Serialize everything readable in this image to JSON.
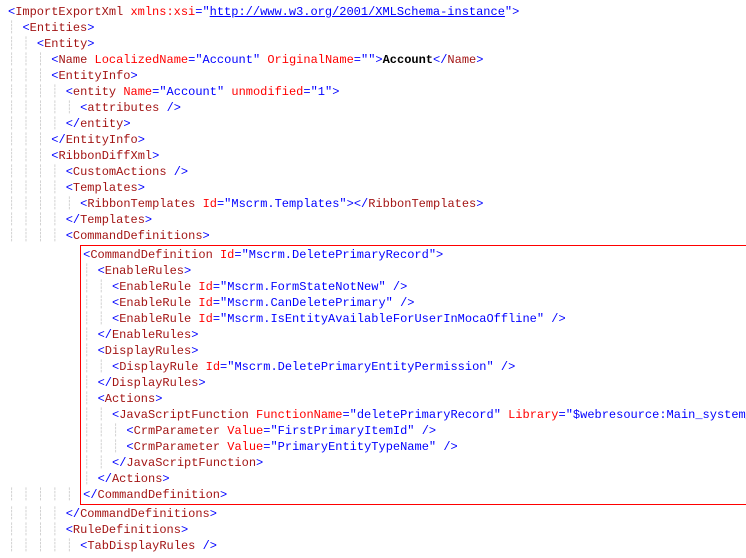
{
  "xsi_url": "http://www.w3.org/2001/XMLSchema-instance",
  "lines": [
    {
      "indent": 0,
      "parts": [
        {
          "t": "bracket",
          "v": "<"
        },
        {
          "t": "tag",
          "v": "ImportExportXml"
        },
        {
          "t": "plain",
          "v": " "
        },
        {
          "t": "attr-name",
          "v": "xmlns:xsi"
        },
        {
          "t": "bracket",
          "v": "="
        },
        {
          "t": "bracket",
          "v": "\""
        },
        {
          "t": "xsi",
          "v": "http://www.w3.org/2001/XMLSchema-instance"
        },
        {
          "t": "bracket",
          "v": "\""
        },
        {
          "t": "bracket",
          "v": ">"
        }
      ]
    },
    {
      "indent": 1,
      "parts": [
        {
          "t": "bracket",
          "v": "<"
        },
        {
          "t": "tag",
          "v": "Entities"
        },
        {
          "t": "bracket",
          "v": ">"
        }
      ]
    },
    {
      "indent": 2,
      "parts": [
        {
          "t": "bracket",
          "v": "<"
        },
        {
          "t": "tag",
          "v": "Entity"
        },
        {
          "t": "bracket",
          "v": ">"
        }
      ]
    },
    {
      "indent": 3,
      "parts": [
        {
          "t": "bracket",
          "v": "<"
        },
        {
          "t": "tag",
          "v": "Name"
        },
        {
          "t": "plain",
          "v": " "
        },
        {
          "t": "attr-name",
          "v": "LocalizedName"
        },
        {
          "t": "bracket",
          "v": "=\""
        },
        {
          "t": "attr-val",
          "v": "Account"
        },
        {
          "t": "bracket",
          "v": "\""
        },
        {
          "t": "plain",
          "v": " "
        },
        {
          "t": "attr-name",
          "v": "OriginalName"
        },
        {
          "t": "bracket",
          "v": "=\""
        },
        {
          "t": "attr-val",
          "v": ""
        },
        {
          "t": "bracket",
          "v": "\""
        },
        {
          "t": "bracket",
          "v": ">"
        },
        {
          "t": "text-content",
          "v": "Account"
        },
        {
          "t": "bracket",
          "v": "</"
        },
        {
          "t": "tag",
          "v": "Name"
        },
        {
          "t": "bracket",
          "v": ">"
        }
      ]
    },
    {
      "indent": 3,
      "parts": [
        {
          "t": "bracket",
          "v": "<"
        },
        {
          "t": "tag",
          "v": "EntityInfo"
        },
        {
          "t": "bracket",
          "v": ">"
        }
      ]
    },
    {
      "indent": 4,
      "parts": [
        {
          "t": "bracket",
          "v": "<"
        },
        {
          "t": "tag",
          "v": "entity"
        },
        {
          "t": "plain",
          "v": " "
        },
        {
          "t": "attr-name",
          "v": "Name"
        },
        {
          "t": "bracket",
          "v": "=\""
        },
        {
          "t": "attr-val",
          "v": "Account"
        },
        {
          "t": "bracket",
          "v": "\""
        },
        {
          "t": "plain",
          "v": " "
        },
        {
          "t": "attr-name",
          "v": "unmodified"
        },
        {
          "t": "bracket",
          "v": "=\""
        },
        {
          "t": "attr-val",
          "v": "1"
        },
        {
          "t": "bracket",
          "v": "\""
        },
        {
          "t": "bracket",
          "v": ">"
        }
      ]
    },
    {
      "indent": 5,
      "parts": [
        {
          "t": "bracket",
          "v": "<"
        },
        {
          "t": "tag",
          "v": "attributes"
        },
        {
          "t": "plain",
          "v": " "
        },
        {
          "t": "bracket",
          "v": "/>"
        }
      ]
    },
    {
      "indent": 4,
      "parts": [
        {
          "t": "bracket",
          "v": "</"
        },
        {
          "t": "tag",
          "v": "entity"
        },
        {
          "t": "bracket",
          "v": ">"
        }
      ]
    },
    {
      "indent": 3,
      "parts": [
        {
          "t": "bracket",
          "v": "</"
        },
        {
          "t": "tag",
          "v": "EntityInfo"
        },
        {
          "t": "bracket",
          "v": ">"
        }
      ]
    },
    {
      "indent": 3,
      "parts": [
        {
          "t": "bracket",
          "v": "<"
        },
        {
          "t": "tag",
          "v": "RibbonDiffXml"
        },
        {
          "t": "bracket",
          "v": ">"
        }
      ]
    },
    {
      "indent": 4,
      "parts": [
        {
          "t": "bracket",
          "v": "<"
        },
        {
          "t": "tag",
          "v": "CustomActions"
        },
        {
          "t": "plain",
          "v": " "
        },
        {
          "t": "bracket",
          "v": "/>"
        }
      ]
    },
    {
      "indent": 4,
      "parts": [
        {
          "t": "bracket",
          "v": "<"
        },
        {
          "t": "tag",
          "v": "Templates"
        },
        {
          "t": "bracket",
          "v": ">"
        }
      ]
    },
    {
      "indent": 5,
      "parts": [
        {
          "t": "bracket",
          "v": "<"
        },
        {
          "t": "tag",
          "v": "RibbonTemplates"
        },
        {
          "t": "plain",
          "v": " "
        },
        {
          "t": "attr-name",
          "v": "Id"
        },
        {
          "t": "bracket",
          "v": "=\""
        },
        {
          "t": "attr-val",
          "v": "Mscrm.Templates"
        },
        {
          "t": "bracket",
          "v": "\""
        },
        {
          "t": "bracket",
          "v": ">"
        },
        {
          "t": "bracket",
          "v": "</"
        },
        {
          "t": "tag",
          "v": "RibbonTemplates"
        },
        {
          "t": "bracket",
          "v": ">"
        }
      ]
    },
    {
      "indent": 4,
      "parts": [
        {
          "t": "bracket",
          "v": "</"
        },
        {
          "t": "tag",
          "v": "Templates"
        },
        {
          "t": "bracket",
          "v": ">"
        }
      ]
    },
    {
      "indent": 4,
      "parts": [
        {
          "t": "bracket",
          "v": "<"
        },
        {
          "t": "tag",
          "v": "CommandDefinitions"
        },
        {
          "t": "bracket",
          "v": ">"
        }
      ]
    }
  ],
  "boxed_lines": [
    {
      "indent": 5,
      "parts": [
        {
          "t": "bracket",
          "v": "<"
        },
        {
          "t": "tag",
          "v": "CommandDefinition"
        },
        {
          "t": "plain",
          "v": " "
        },
        {
          "t": "attr-name",
          "v": "Id"
        },
        {
          "t": "bracket",
          "v": "=\""
        },
        {
          "t": "attr-val",
          "v": "Mscrm.DeletePrimaryRecord"
        },
        {
          "t": "bracket",
          "v": "\""
        },
        {
          "t": "bracket",
          "v": ">"
        }
      ]
    },
    {
      "indent": 6,
      "parts": [
        {
          "t": "bracket",
          "v": "<"
        },
        {
          "t": "tag",
          "v": "EnableRules"
        },
        {
          "t": "bracket",
          "v": ">"
        }
      ]
    },
    {
      "indent": 7,
      "parts": [
        {
          "t": "bracket",
          "v": "<"
        },
        {
          "t": "tag",
          "v": "EnableRule"
        },
        {
          "t": "plain",
          "v": " "
        },
        {
          "t": "attr-name",
          "v": "Id"
        },
        {
          "t": "bracket",
          "v": "=\""
        },
        {
          "t": "attr-val",
          "v": "Mscrm.FormStateNotNew"
        },
        {
          "t": "bracket",
          "v": "\""
        },
        {
          "t": "plain",
          "v": " "
        },
        {
          "t": "bracket",
          "v": "/>"
        }
      ]
    },
    {
      "indent": 7,
      "parts": [
        {
          "t": "bracket",
          "v": "<"
        },
        {
          "t": "tag",
          "v": "EnableRule"
        },
        {
          "t": "plain",
          "v": " "
        },
        {
          "t": "attr-name",
          "v": "Id"
        },
        {
          "t": "bracket",
          "v": "=\""
        },
        {
          "t": "attr-val",
          "v": "Mscrm.CanDeletePrimary"
        },
        {
          "t": "bracket",
          "v": "\""
        },
        {
          "t": "plain",
          "v": " "
        },
        {
          "t": "bracket",
          "v": "/>"
        }
      ]
    },
    {
      "indent": 7,
      "parts": [
        {
          "t": "bracket",
          "v": "<"
        },
        {
          "t": "tag",
          "v": "EnableRule"
        },
        {
          "t": "plain",
          "v": " "
        },
        {
          "t": "attr-name",
          "v": "Id"
        },
        {
          "t": "bracket",
          "v": "=\""
        },
        {
          "t": "attr-val",
          "v": "Mscrm.IsEntityAvailableForUserInMocaOffline"
        },
        {
          "t": "bracket",
          "v": "\""
        },
        {
          "t": "plain",
          "v": " "
        },
        {
          "t": "bracket",
          "v": "/>"
        }
      ]
    },
    {
      "indent": 6,
      "parts": [
        {
          "t": "bracket",
          "v": "</"
        },
        {
          "t": "tag",
          "v": "EnableRules"
        },
        {
          "t": "bracket",
          "v": ">"
        }
      ]
    },
    {
      "indent": 6,
      "parts": [
        {
          "t": "bracket",
          "v": "<"
        },
        {
          "t": "tag",
          "v": "DisplayRules"
        },
        {
          "t": "bracket",
          "v": ">"
        }
      ]
    },
    {
      "indent": 7,
      "parts": [
        {
          "t": "bracket",
          "v": "<"
        },
        {
          "t": "tag",
          "v": "DisplayRule"
        },
        {
          "t": "plain",
          "v": " "
        },
        {
          "t": "attr-name",
          "v": "Id"
        },
        {
          "t": "bracket",
          "v": "=\""
        },
        {
          "t": "attr-val",
          "v": "Mscrm.DeletePrimaryEntityPermission"
        },
        {
          "t": "bracket",
          "v": "\""
        },
        {
          "t": "plain",
          "v": " "
        },
        {
          "t": "bracket",
          "v": "/>"
        }
      ]
    },
    {
      "indent": 6,
      "parts": [
        {
          "t": "bracket",
          "v": "</"
        },
        {
          "t": "tag",
          "v": "DisplayRules"
        },
        {
          "t": "bracket",
          "v": ">"
        }
      ]
    },
    {
      "indent": 6,
      "parts": [
        {
          "t": "bracket",
          "v": "<"
        },
        {
          "t": "tag",
          "v": "Actions"
        },
        {
          "t": "bracket",
          "v": ">"
        }
      ]
    },
    {
      "indent": 7,
      "parts": [
        {
          "t": "bracket",
          "v": "<"
        },
        {
          "t": "tag",
          "v": "JavaScriptFunction"
        },
        {
          "t": "plain",
          "v": " "
        },
        {
          "t": "attr-name",
          "v": "FunctionName"
        },
        {
          "t": "bracket",
          "v": "=\""
        },
        {
          "t": "attr-val",
          "v": "deletePrimaryRecord"
        },
        {
          "t": "bracket",
          "v": "\""
        },
        {
          "t": "plain",
          "v": " "
        },
        {
          "t": "attr-name",
          "v": "Library"
        },
        {
          "t": "bracket",
          "v": "=\""
        },
        {
          "t": "attr-val",
          "v": "$webresource:Main_system_library.js"
        },
        {
          "t": "bracket",
          "v": "\""
        },
        {
          "t": "bracket",
          "v": ">"
        }
      ]
    },
    {
      "indent": 8,
      "parts": [
        {
          "t": "bracket",
          "v": "<"
        },
        {
          "t": "tag",
          "v": "CrmParameter"
        },
        {
          "t": "plain",
          "v": " "
        },
        {
          "t": "attr-name",
          "v": "Value"
        },
        {
          "t": "bracket",
          "v": "=\""
        },
        {
          "t": "attr-val",
          "v": "FirstPrimaryItemId"
        },
        {
          "t": "bracket",
          "v": "\""
        },
        {
          "t": "plain",
          "v": " "
        },
        {
          "t": "bracket",
          "v": "/>"
        }
      ]
    },
    {
      "indent": 8,
      "parts": [
        {
          "t": "bracket",
          "v": "<"
        },
        {
          "t": "tag",
          "v": "CrmParameter"
        },
        {
          "t": "plain",
          "v": " "
        },
        {
          "t": "attr-name",
          "v": "Value"
        },
        {
          "t": "bracket",
          "v": "=\""
        },
        {
          "t": "attr-val",
          "v": "PrimaryEntityTypeName"
        },
        {
          "t": "bracket",
          "v": "\""
        },
        {
          "t": "plain",
          "v": " "
        },
        {
          "t": "bracket",
          "v": "/>"
        }
      ]
    },
    {
      "indent": 7,
      "parts": [
        {
          "t": "bracket",
          "v": "</"
        },
        {
          "t": "tag",
          "v": "JavaScriptFunction"
        },
        {
          "t": "bracket",
          "v": ">"
        }
      ]
    },
    {
      "indent": 6,
      "parts": [
        {
          "t": "bracket",
          "v": "</"
        },
        {
          "t": "tag",
          "v": "Actions"
        },
        {
          "t": "bracket",
          "v": ">"
        }
      ]
    },
    {
      "indent": 5,
      "parts": [
        {
          "t": "bracket",
          "v": "</"
        },
        {
          "t": "tag",
          "v": "CommandDefinition"
        },
        {
          "t": "bracket",
          "v": ">"
        }
      ]
    }
  ],
  "after_lines": [
    {
      "indent": 4,
      "parts": [
        {
          "t": "bracket",
          "v": "</"
        },
        {
          "t": "tag",
          "v": "CommandDefinitions"
        },
        {
          "t": "bracket",
          "v": ">"
        }
      ]
    },
    {
      "indent": 4,
      "parts": [
        {
          "t": "bracket",
          "v": "<"
        },
        {
          "t": "tag",
          "v": "RuleDefinitions"
        },
        {
          "t": "bracket",
          "v": ">"
        }
      ]
    },
    {
      "indent": 5,
      "parts": [
        {
          "t": "bracket",
          "v": "<"
        },
        {
          "t": "tag",
          "v": "TabDisplayRules"
        },
        {
          "t": "plain",
          "v": " "
        },
        {
          "t": "bracket",
          "v": "/>"
        }
      ]
    }
  ]
}
